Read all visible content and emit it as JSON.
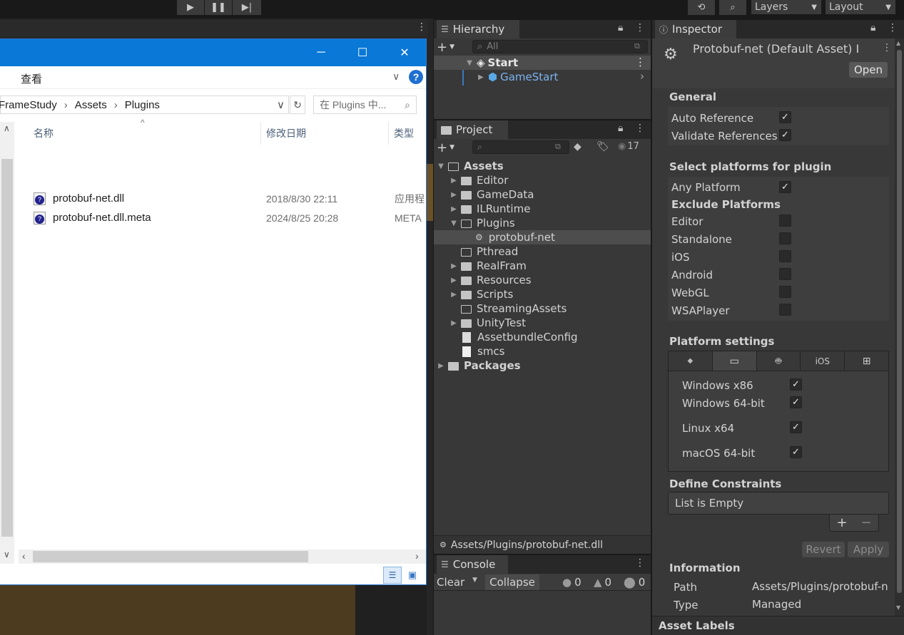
{
  "toolbar": {
    "layers_label": "Layers",
    "layout_label": "Layout"
  },
  "explorer": {
    "minimize": "─",
    "maximize": "☐",
    "close": "✕",
    "ribbon_tab": "查看",
    "help": "?",
    "breadcrumb": [
      "FrameStudy",
      "Assets",
      "Plugins"
    ],
    "search_placeholder": "在 Plugins 中...",
    "columns": {
      "name": "名称",
      "modified": "修改日期",
      "type": "类型"
    },
    "files": [
      {
        "name": "protobuf-net.dll",
        "modified": "2018/8/30 22:11",
        "type": "应用程"
      },
      {
        "name": "protobuf-net.dll.meta",
        "modified": "2024/8/25 20:28",
        "type": "META"
      }
    ]
  },
  "hierarchy": {
    "tab": "Hierarchy",
    "search_placeholder": "All",
    "items": [
      {
        "label": "Start"
      },
      {
        "label": "GameStart"
      }
    ]
  },
  "project": {
    "tab": "Project",
    "hidden_count": "17",
    "tree": [
      {
        "label": "Assets"
      },
      {
        "label": "Editor"
      },
      {
        "label": "GameData"
      },
      {
        "label": "ILRuntime"
      },
      {
        "label": "Plugins"
      },
      {
        "label": "protobuf-net"
      },
      {
        "label": "Pthread"
      },
      {
        "label": "RealFram"
      },
      {
        "label": "Resources"
      },
      {
        "label": "Scripts"
      },
      {
        "label": "StreamingAssets"
      },
      {
        "label": "UnityTest"
      },
      {
        "label": "AssetbundleConfig"
      },
      {
        "label": "smcs"
      },
      {
        "label": "Packages"
      }
    ],
    "path": "Assets/Plugins/protobuf-net.dll"
  },
  "console": {
    "tab": "Console",
    "clear": "Clear",
    "collapse": "Collapse",
    "logs": "0",
    "warnings": "0",
    "errors": "0"
  },
  "inspector": {
    "tab": "Inspector",
    "title": "Protobuf-net (Default Asset) I",
    "open_button": "Open",
    "general_header": "General",
    "auto_reference": "Auto Reference",
    "validate_references": "Validate References",
    "select_platforms_header": "Select platforms for plugin",
    "any_platform": "Any Platform",
    "exclude_platforms": "Exclude Platforms",
    "exclude": [
      {
        "label": "Editor"
      },
      {
        "label": "Standalone"
      },
      {
        "label": "iOS"
      },
      {
        "label": "Android"
      },
      {
        "label": "WebGL"
      },
      {
        "label": "WSAPlayer"
      }
    ],
    "platform_settings_header": "Platform settings",
    "platform_tab_ios": "iOS",
    "standalone": [
      {
        "label": "Windows x86"
      },
      {
        "label": "Windows 64-bit"
      },
      {
        "label": "Linux x64"
      },
      {
        "label": "macOS 64-bit"
      }
    ],
    "define_constraints_header": "Define Constraints",
    "list_empty": "List is Empty",
    "plus": "+",
    "minus": "−",
    "revert": "Revert",
    "apply": "Apply",
    "information_header": "Information",
    "path_label": "Path",
    "path_value": "Assets/Plugins/protobuf-n",
    "type_label": "Type",
    "type_value": "Managed",
    "asset_labels": "Asset Labels"
  }
}
